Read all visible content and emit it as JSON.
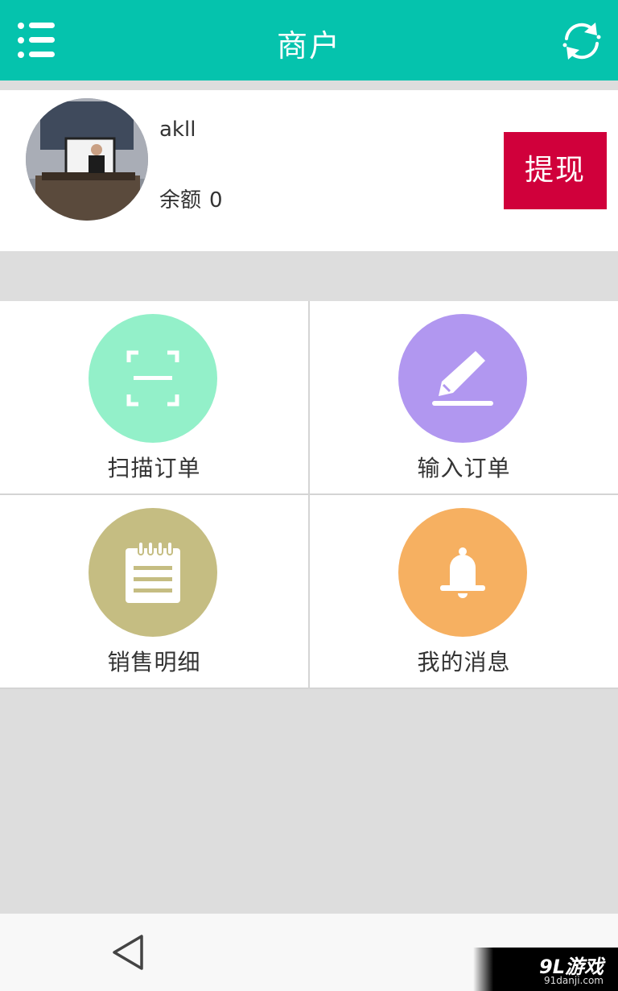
{
  "header": {
    "title": "商户",
    "menu_icon": "menu-list-icon",
    "refresh_icon": "refresh-icon",
    "background": "#05c3ad"
  },
  "profile": {
    "username": "akll",
    "balance_label": "余额",
    "balance_value": "0",
    "withdraw_label": "提现",
    "withdraw_color": "#d0003b"
  },
  "actions": [
    {
      "label": "扫描订单",
      "icon": "scan-icon",
      "color": "#93f0c9"
    },
    {
      "label": "输入订单",
      "icon": "pencil-icon",
      "color": "#b197f0"
    },
    {
      "label": "销售明细",
      "icon": "notepad-icon",
      "color": "#c5bd82"
    },
    {
      "label": "我的消息",
      "icon": "bell-icon",
      "color": "#f6b061"
    }
  ],
  "navbar": {
    "back_icon": "back-triangle-icon"
  },
  "watermark": {
    "brand": "9L游戏",
    "url": "91danji.com"
  }
}
